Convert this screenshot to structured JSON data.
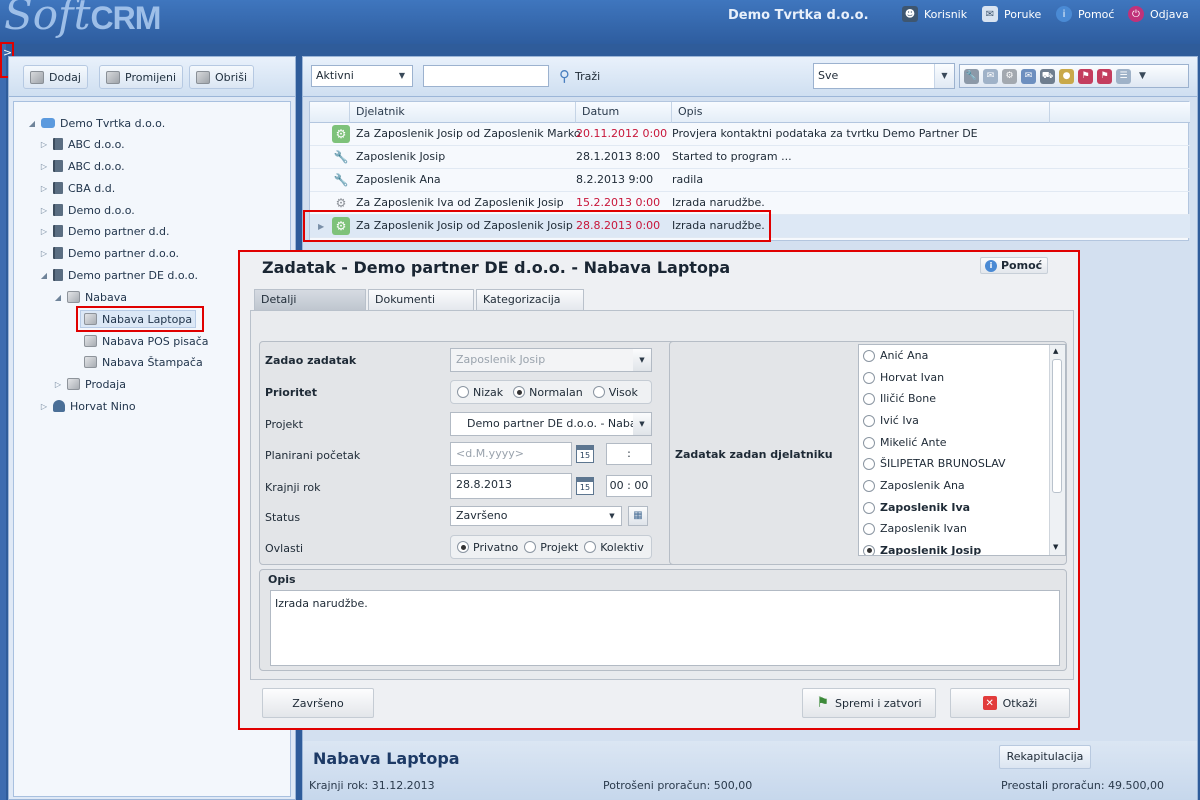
{
  "app": {
    "logo_soft": "Soft",
    "logo_crm": "CRM",
    "company": "Demo Tvrtka d.o.o."
  },
  "topnav": [
    {
      "label": "Korisnik",
      "icon": "user-icon"
    },
    {
      "label": "Poruke",
      "icon": "messages-icon"
    },
    {
      "label": "Pomoć",
      "icon": "info-icon"
    },
    {
      "label": "Odjava",
      "icon": "power-icon"
    }
  ],
  "toggle_glyph": ">",
  "left_toolbar": {
    "add": "Dodaj",
    "edit": "Promijeni",
    "delete": "Obriši"
  },
  "tree": {
    "root": "Demo Tvrtka d.o.o.",
    "companies": [
      "ABC d.o.o.",
      "ABC d.o.o.",
      "CBA d.d.",
      "Demo d.o.o.",
      "Demo partner d.d.",
      "Demo partner d.o.o.",
      "Demo partner DE d.o.o."
    ],
    "group": "Nabava",
    "group_items": [
      "Nabava Laptopa",
      "Nabava POS pisača",
      "Nabava Štampača"
    ],
    "group2": "Prodaja",
    "person": "Horvat Nino"
  },
  "main_toolbar": {
    "status_filter": "Aktivni",
    "search_value": "",
    "search_button": "Traži",
    "type_filter": "Sve"
  },
  "grid": {
    "columns": [
      "Djelatnik",
      "Datum",
      "Opis"
    ],
    "rows": [
      {
        "employee": "Za Zaposlenik Josip od Zaposlenik Marko",
        "date": "20.11.2012 0:00",
        "desc": "Provjera kontaktni podataka za tvrtku Demo Partner DE",
        "overdue": true
      },
      {
        "employee": "Zaposlenik Josip",
        "date": "28.1.2013 8:00",
        "desc": "Started to program ...",
        "overdue": false
      },
      {
        "employee": "Zaposlenik Ana",
        "date": "8.2.2013 9:00",
        "desc": "radila",
        "overdue": false
      },
      {
        "employee": "Za Zaposlenik Iva od Zaposlenik Josip",
        "date": "15.2.2013 0:00",
        "desc": "Izrada narudžbe.",
        "overdue": true
      },
      {
        "employee": "Za Zaposlenik Josip od Zaposlenik Josip",
        "date": "28.8.2013 0:00",
        "desc": "Izrada narudžbe.",
        "overdue": true
      }
    ]
  },
  "dialog": {
    "title": "Zadatak - Demo partner DE d.o.o. - Nabava Laptopa",
    "help": "Pomoć",
    "tabs": [
      "Detalji",
      "Dokumenti",
      "Kategorizacija"
    ],
    "fields": {
      "assigned_by_label": "Zadao zadatak",
      "assigned_by_value": "Zaposlenik Josip",
      "priority_label": "Prioritet",
      "priority_options": [
        "Nizak",
        "Normalan",
        "Visok"
      ],
      "project_label": "Projekt",
      "project_value": "Demo partner DE d.o.o. - Nabava",
      "start_label": "Planirani početak",
      "start_placeholder": "<d.M.yyyy>",
      "start_time": ":",
      "deadline_label": "Krajnji rok",
      "deadline_value": "28.8.2013",
      "deadline_time": "00 : 00",
      "status_label": "Status",
      "status_value": "Završeno",
      "rights_label": "Ovlasti",
      "rights_options": [
        "Privatno",
        "Projekt",
        "Kolektiv"
      ],
      "cal_day": "15"
    },
    "assigned_to_label": "Zadatak zadan djelatniku",
    "employees": [
      "Anić Ana",
      "Horvat Ivan",
      "Iličić  Bone",
      "Ivić Iva",
      "Mikelić Ante",
      "ŠILIPETAR BRUNOSLAV",
      "Zaposlenik Ana",
      "Zaposlenik Iva",
      "Zaposlenik Ivan",
      "Zaposlenik Josip"
    ],
    "opis_label": "Opis",
    "opis_value": "Izrada narudžbe.",
    "buttons": {
      "done": "Završeno",
      "save": "Spremi i zatvori",
      "cancel": "Otkaži"
    }
  },
  "summary": {
    "title": "Nabava Laptopa",
    "recap": "Rekapitulacija",
    "deadline": "Krajnji rok: 31.12.2013",
    "spent": "Potrošeni proračun: 500,00",
    "remaining": "Preostali proračun: 49.500,00"
  },
  "colors": {
    "accent": "#2e5d9f",
    "overdue": "#c8163a",
    "highlight": "#e00000"
  }
}
